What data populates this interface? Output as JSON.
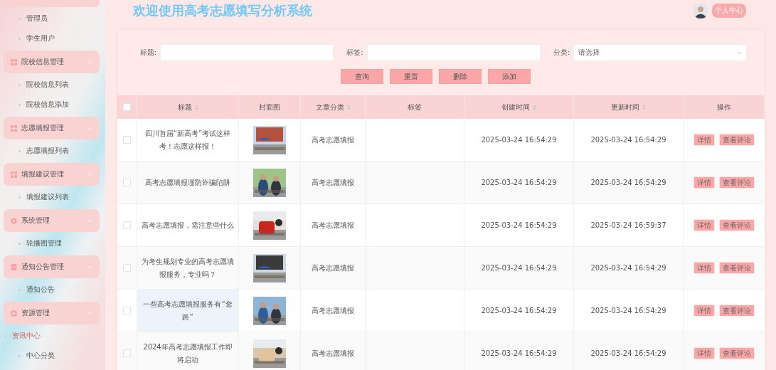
{
  "sidebar": {
    "groups": [
      {
        "children": [
          {
            "label": "管理员",
            "selected": false
          },
          {
            "label": "学生用户",
            "selected": false
          }
        ]
      },
      {
        "label": "院校信息管理",
        "kind": "grid",
        "expanded": true,
        "children": [
          {
            "label": "院校信息列表",
            "selected": false
          },
          {
            "label": "院校信息添加",
            "selected": false
          }
        ]
      },
      {
        "label": "志愿填报管理",
        "kind": "grid",
        "expanded": true,
        "children": [
          {
            "label": "志愿填报列表",
            "selected": false
          }
        ]
      },
      {
        "label": "填报建议管理",
        "kind": "grid",
        "expanded": true,
        "children": [
          {
            "label": "填报建议列表",
            "selected": false
          }
        ]
      },
      {
        "label": "系统管理",
        "kind": "gear",
        "expanded": true,
        "children": [
          {
            "label": "轮播图管理",
            "selected": false
          }
        ]
      },
      {
        "label": "通知公告管理",
        "kind": "doc",
        "expanded": true,
        "children": [
          {
            "label": "通知公告",
            "selected": false
          }
        ]
      },
      {
        "label": "资源管理",
        "kind": "plus",
        "expanded": true,
        "children": [
          {
            "label": "资讯中心",
            "selected": true
          },
          {
            "label": "中心分类",
            "selected": false
          }
        ]
      }
    ]
  },
  "header": {
    "title": "欢迎使用高考志愿填写分析系统",
    "user_button": "个人中心"
  },
  "search": {
    "fields": [
      {
        "label": "标题:",
        "kind": "input"
      },
      {
        "label": "标签:",
        "kind": "input"
      },
      {
        "label": "分类:",
        "kind": "select",
        "placeholder": "请选择"
      }
    ],
    "buttons": [
      "查询",
      "重置",
      "删除",
      "添加"
    ]
  },
  "table": {
    "select_all": false,
    "columns": [
      {
        "label": "标题",
        "sortable": true
      },
      {
        "label": "封面图",
        "sortable": false
      },
      {
        "label": "文章分类",
        "sortable": true
      },
      {
        "label": "标签",
        "sortable": false
      },
      {
        "label": "创建时间",
        "sortable": true
      },
      {
        "label": "更新时间",
        "sortable": true
      },
      {
        "label": "操作",
        "sortable": false
      }
    ],
    "rows": [
      {
        "checked": false,
        "hovered": false,
        "title": "四川首届“新高考”考试这样考！志愿这样报！",
        "category": "高考志愿填报",
        "created": "2025-03-24 16:54:29",
        "updated": "2025-03-24 16:54:29",
        "actions": [
          "详情",
          "查看评论"
        ]
      },
      {
        "checked": false,
        "hovered": false,
        "title": "高考志愿填报谨防诈骗陷阱",
        "category": "高考志愿填报",
        "created": "2025-03-24 16:54:29",
        "updated": "2025-03-24 16:54:29",
        "actions": [
          "详情",
          "查看评论"
        ]
      },
      {
        "checked": false,
        "hovered": false,
        "title": "高考志愿填报，需注意些什么",
        "category": "高考志愿填报",
        "created": "2025-03-24 16:54:29",
        "updated": "2025-03-24 16:59:37",
        "actions": [
          "详情",
          "查看评论"
        ]
      },
      {
        "checked": false,
        "hovered": false,
        "title": "为考生规划专业的高考志愿填报服务，专业吗？",
        "category": "高考志愿填报",
        "created": "2025-03-24 16:54:29",
        "updated": "2025-03-24 16:54:29",
        "actions": [
          "详情",
          "查看评论"
        ]
      },
      {
        "checked": false,
        "hovered": true,
        "title": "一些高考志愿填报服务有“套路”",
        "category": "高考志愿填报",
        "created": "2025-03-24 16:54:29",
        "updated": "2025-03-24 16:54:29",
        "actions": [
          "详情",
          "查看评论"
        ]
      },
      {
        "checked": false,
        "hovered": false,
        "title": "2024年高考志愿填报工作即将启动",
        "category": "高考志愿填报",
        "created": "2025-03-24 16:54:29",
        "updated": "2025-03-24 16:54:29",
        "actions": [
          "详情",
          "查看评论"
        ]
      }
    ]
  }
}
